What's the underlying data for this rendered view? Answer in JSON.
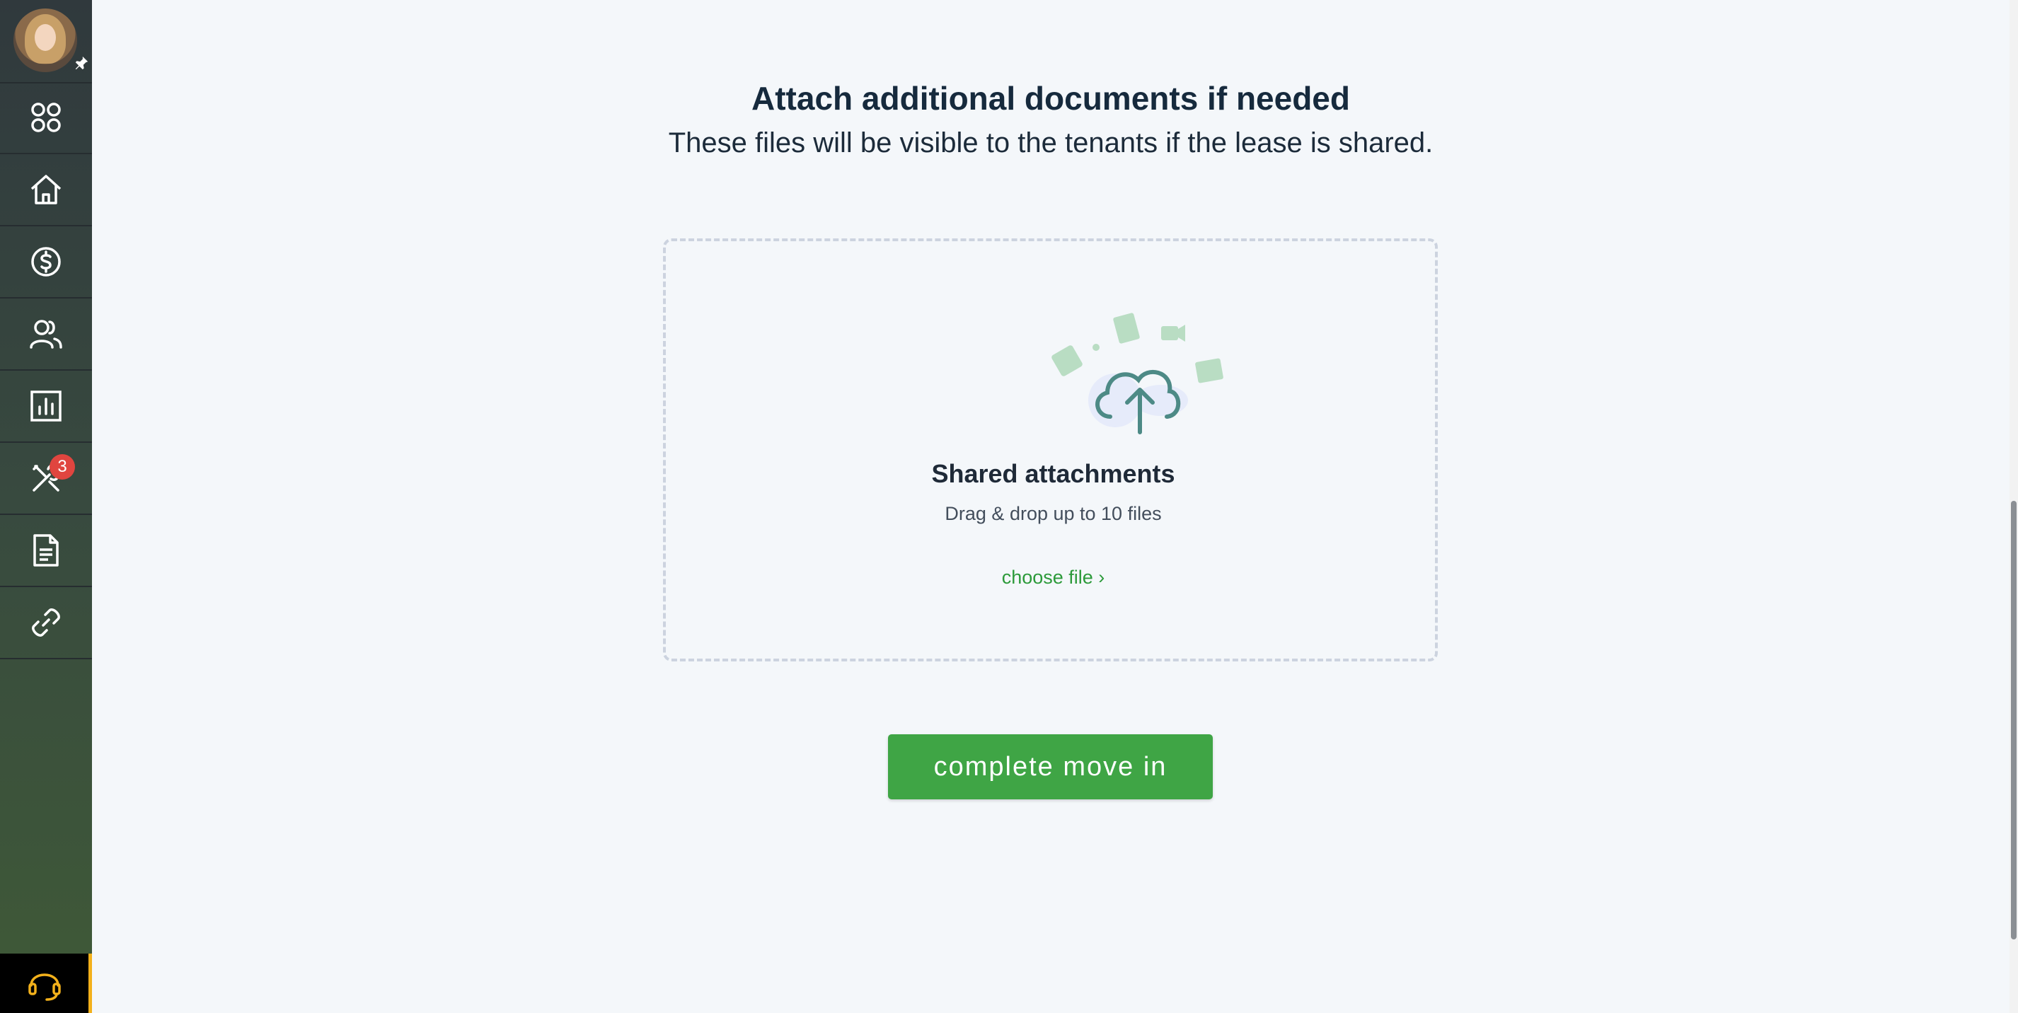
{
  "sidebar": {
    "items": [
      {
        "name": "apps",
        "icon": "grid-icon"
      },
      {
        "name": "home",
        "icon": "home-icon"
      },
      {
        "name": "payments",
        "icon": "dollar-icon"
      },
      {
        "name": "people",
        "icon": "people-icon"
      },
      {
        "name": "reports",
        "icon": "chart-icon"
      },
      {
        "name": "maintenance",
        "icon": "tools-icon",
        "badge": "3"
      },
      {
        "name": "documents",
        "icon": "document-icon"
      },
      {
        "name": "links",
        "icon": "link-icon"
      }
    ],
    "support_icon": "headset-icon",
    "accent_color": "#f3b11b",
    "badge_color": "#e0453f"
  },
  "main": {
    "title": "Attach additional documents if needed",
    "subtitle": "These files will be visible to the tenants if the lease is shared.",
    "dropzone": {
      "title": "Shared attachments",
      "hint": "Drag & drop up to 10 files",
      "choose_label": "choose file ›"
    },
    "complete_button": "complete move in",
    "primary_color": "#3fa545"
  }
}
